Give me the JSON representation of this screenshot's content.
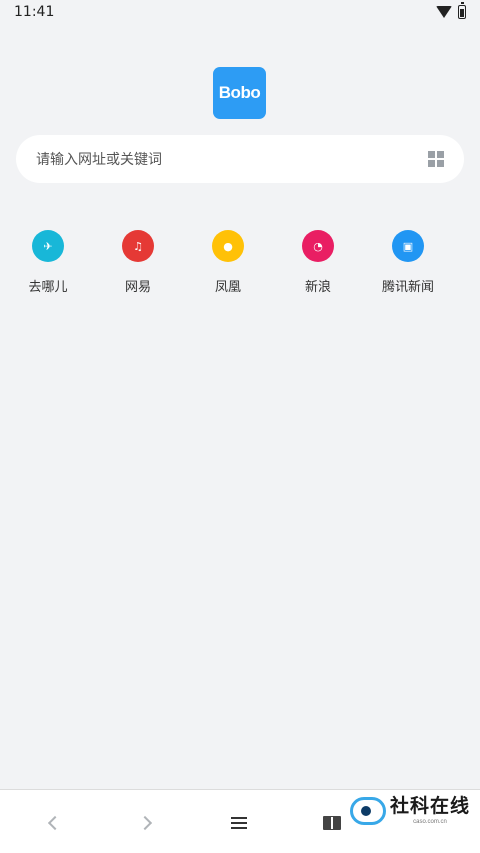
{
  "status_bar": {
    "time": "11:41",
    "wifi_icon": "wifi-icon",
    "battery_icon": "battery-icon"
  },
  "logo": {
    "text": "Bobo",
    "color": "#2d9cf4"
  },
  "search": {
    "placeholder": "请输入网址或关键词",
    "qr_icon": "qr-scan-icon"
  },
  "shortcuts": [
    {
      "label": "去哪儿",
      "icon": "airplane-icon",
      "glyph": "✈",
      "color": "#18b7d8"
    },
    {
      "label": "网易",
      "icon": "music-note-icon",
      "glyph": "♫",
      "color": "#e53935"
    },
    {
      "label": "凤凰",
      "icon": "fire-icon",
      "glyph": "●",
      "color": "#ffc107"
    },
    {
      "label": "新浪",
      "icon": "rss-icon",
      "glyph": "◔",
      "color": "#e91e63"
    },
    {
      "label": "腾讯新闻",
      "icon": "news-icon",
      "glyph": "▣",
      "color": "#2196f3"
    }
  ],
  "bottom_bar": {
    "back_icon": "chevron-left-icon",
    "forward_icon": "chevron-right-icon",
    "menu_icon": "menu-icon",
    "bookmarks_icon": "book-icon"
  },
  "watermark": {
    "title": "社科在线",
    "subtitle": "caso.com.cn"
  }
}
